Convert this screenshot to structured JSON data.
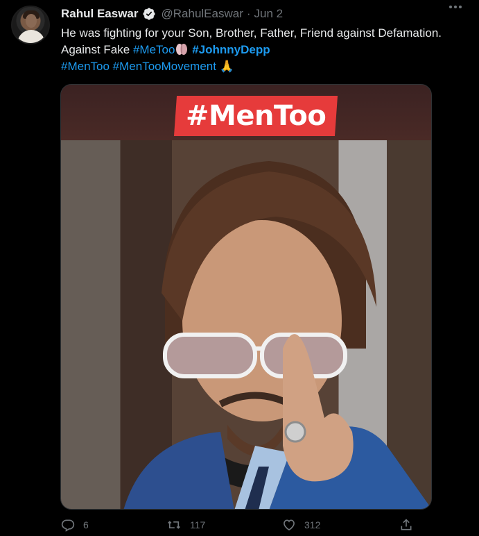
{
  "tweet": {
    "author_name": "Rahul Easwar",
    "handle": "@RahulEaswar",
    "separator": "·",
    "date": "Jun 2",
    "text_line1": "He was fighting for your Son, Brother, Father, Friend against Defamation.",
    "text_line2_prefix": "Against Fake",
    "hashtag_metoo": "#MeToo",
    "hashtag_johnnydepp": "#JohnnyDepp",
    "hashtag_mentoo": "#MenToo",
    "hashtag_mentoomovement": "#MenTooMovement",
    "emoji_pray": "🙏",
    "media_banner": "#MenToo"
  },
  "actions": {
    "reply_count": "6",
    "retweet_count": "117",
    "like_count": "312"
  },
  "icons": {
    "verified": "verified-badge-icon",
    "reply": "reply-icon",
    "retweet": "retweet-icon",
    "like": "heart-icon",
    "share": "share-icon",
    "more": "more-icon",
    "metoo_emoji": "metoo-hashflag-icon"
  },
  "colors": {
    "background": "#000000",
    "text": "#e7e9ea",
    "muted": "#71767b",
    "link": "#1d9bf0",
    "banner_red": "#e63b3b"
  }
}
